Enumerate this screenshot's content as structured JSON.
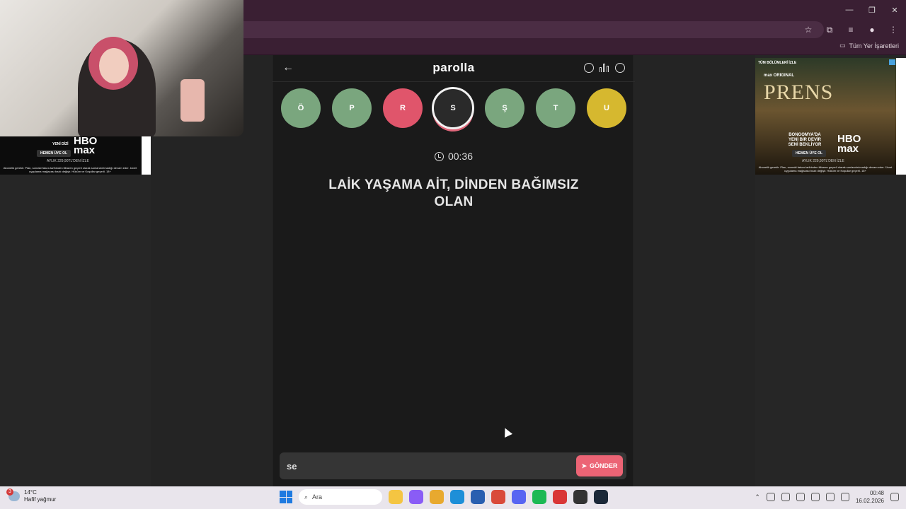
{
  "browser": {
    "bookmarks_all": "Tüm Yer İşaretleri",
    "window_controls": [
      "—",
      "❐",
      "✕"
    ],
    "toolbar_icons": [
      "☆",
      "⧉",
      "≡",
      "●",
      "⋮"
    ]
  },
  "ads": {
    "left": {
      "series": "YENİ DİZİ",
      "brand_top": "HBO",
      "brand_bottom": "max",
      "cta": "HEMEN ÜYE OL",
      "price": "AYLIK 229,90TL'DEN İZLE",
      "legal": "Abonelik gerekir. Plan, sonraki fatura tarihinden itibaren geçerli olarak sonlandırılmadığı devam eder. Ücret uygulama mağazası bazlı değişir. Hüküm ve Koşullar geçerli. 18+"
    },
    "right": {
      "top": "TÜM BÖLÜMLERİ İZLE",
      "sub": "max ORIGINAL",
      "title": "PRENS",
      "promo": "BONGOMYA'DA YENİ BİR DEVİR SENİ BEKLİYOR",
      "brand_top": "HBO",
      "brand_bottom": "max",
      "cta": "HEMEN ÜYE OL",
      "price": "AYLIK 229,90TL'DEN İZLE",
      "legal": "Abonelik gerekir. Plan, sonraki fatura tarihinden itibaren geçerli olarak sonlandırılmadığı devam eder. Ücret uygulama mağazası bazlı değişir. Hüküm ve Koşullar geçerli. 18+"
    }
  },
  "game": {
    "back_icon": "←",
    "logo": "parolla",
    "letters": [
      {
        "char": "Ö",
        "state": "correct",
        "color": "#7aa67e"
      },
      {
        "char": "P",
        "state": "correct",
        "color": "#7aa67e"
      },
      {
        "char": "R",
        "state": "wrong",
        "color": "#e0556b"
      },
      {
        "char": "S",
        "state": "active",
        "color": "#2a2a2a"
      },
      {
        "char": "Ş",
        "state": "correct",
        "color": "#7aa67e"
      },
      {
        "char": "T",
        "state": "correct",
        "color": "#7aa67e"
      },
      {
        "char": "U",
        "state": "pass",
        "color": "#d6b82f"
      }
    ],
    "timer": "00:36",
    "question": "LAİK YAŞAMA AİT, DİNDEN BAĞIMSIZ OLAN",
    "answer_value": "se",
    "send_label": "GÖNDER"
  },
  "taskbar": {
    "weather_badge": "3",
    "temperature": "14°C",
    "condition": "Hafif yağmur",
    "search_placeholder": "Ara",
    "time": "00:48",
    "date": "16.02.2026",
    "apps": [
      {
        "name": "file-explorer",
        "color": "#f4c542"
      },
      {
        "name": "copilot",
        "color": "#8a5cf6"
      },
      {
        "name": "folder",
        "color": "#e8a92f"
      },
      {
        "name": "edge",
        "color": "#1e8fd8"
      },
      {
        "name": "store",
        "color": "#2a5fb0"
      },
      {
        "name": "chrome",
        "color": "#d94a3a"
      },
      {
        "name": "discord",
        "color": "#5865f2"
      },
      {
        "name": "spotify",
        "color": "#1db954"
      },
      {
        "name": "app-red",
        "color": "#d93636"
      },
      {
        "name": "app-dark",
        "color": "#333333"
      },
      {
        "name": "steam",
        "color": "#1b2838"
      }
    ]
  }
}
